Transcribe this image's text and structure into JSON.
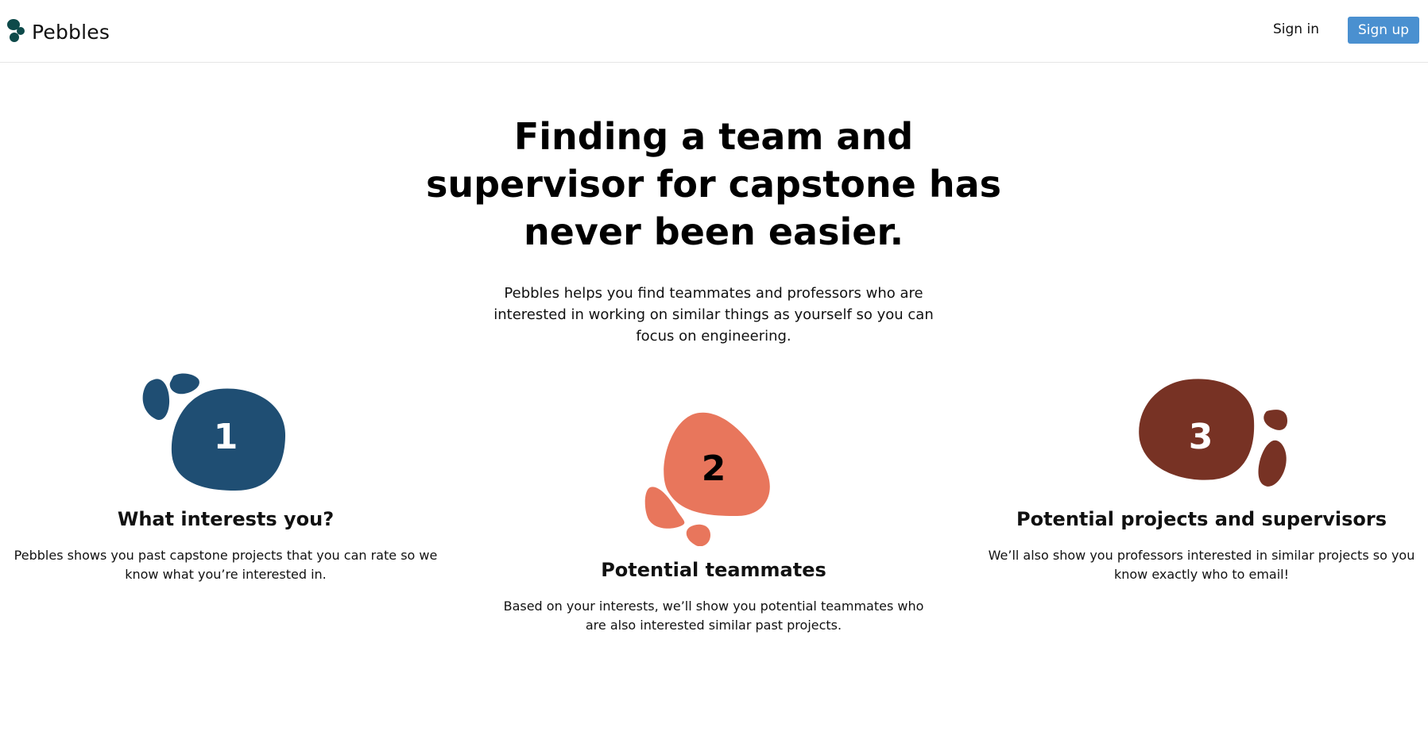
{
  "header": {
    "brand_name": "Pebbles",
    "brand_icon": "pebbles-logo-icon",
    "signin_label": "Sign in",
    "signup_label": "Sign up"
  },
  "hero": {
    "title": "Finding a team and supervisor for capstone has never been easier.",
    "subtitle": "Pebbles helps you find teammates and professors who are interested in working on similar things as yourself so you can focus on engineering."
  },
  "features": [
    {
      "number": "1",
      "title": "What interests you?",
      "description": "Pebbles shows you past capstone projects that you can rate so we know what you’re interested in.",
      "color": "#1f4e73"
    },
    {
      "number": "2",
      "title": "Potential teammates",
      "description": "Based on your interests, we’ll show you potential teammates who are also interested similar past projects.",
      "color": "#e8765c"
    },
    {
      "number": "3",
      "title": "Potential projects and supervisors",
      "description": "We’ll also show you professors interested in similar projects so you know exactly who to email!",
      "color": "#773224"
    }
  ],
  "colors": {
    "signup_button": "#4a90d0",
    "logo": "#0e4a4a"
  }
}
